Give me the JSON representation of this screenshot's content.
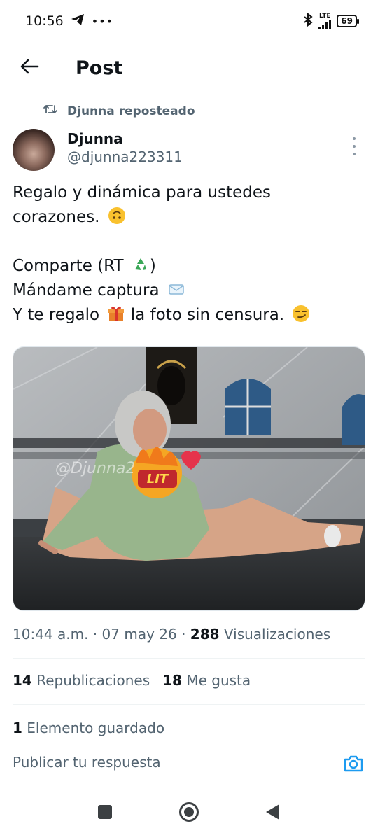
{
  "status_bar": {
    "time": "10:56",
    "network": "LTE",
    "battery": "69",
    "icons": [
      "telegram-icon",
      "more-notifications-icon",
      "bluetooth-icon",
      "signal-icon",
      "battery-icon"
    ]
  },
  "header": {
    "title": "Post",
    "back_icon": "arrow-left-icon"
  },
  "repost_banner": {
    "text": "Djunna reposteado",
    "icon": "repost-icon"
  },
  "author": {
    "display_name": "Djunna",
    "handle": "@djunna223311"
  },
  "post": {
    "lines": [
      "Regalo y dinámica para ustedes",
      "corazones.",
      "Comparte (RT",
      "Mándame captura",
      "Y te regalo",
      "la foto sin censura."
    ],
    "line3_suffix": ")",
    "emojis": [
      "upside-down-face-emoji",
      "recycle-emoji",
      "incoming-envelope-emoji",
      "gift-emoji",
      "smirking-face-emoji"
    ]
  },
  "media": {
    "overlay_watermark": "@Djunna2",
    "sticker_text": "LIT"
  },
  "meta": {
    "time": "10:44 a.m.",
    "date": "07 may 26",
    "views_count": "288",
    "views_label": "Visualizaciones"
  },
  "stats": {
    "reposts_count": "14",
    "reposts_label": "Republicaciones",
    "likes_count": "18",
    "likes_label": "Me gusta"
  },
  "saved": {
    "count": "1",
    "label": "Elemento guardado"
  },
  "reply": {
    "placeholder": "Publicar tu respuesta",
    "accent": "#1d9bf0"
  },
  "nav": {
    "icons": [
      "recents-icon",
      "home-icon",
      "back-icon"
    ]
  }
}
